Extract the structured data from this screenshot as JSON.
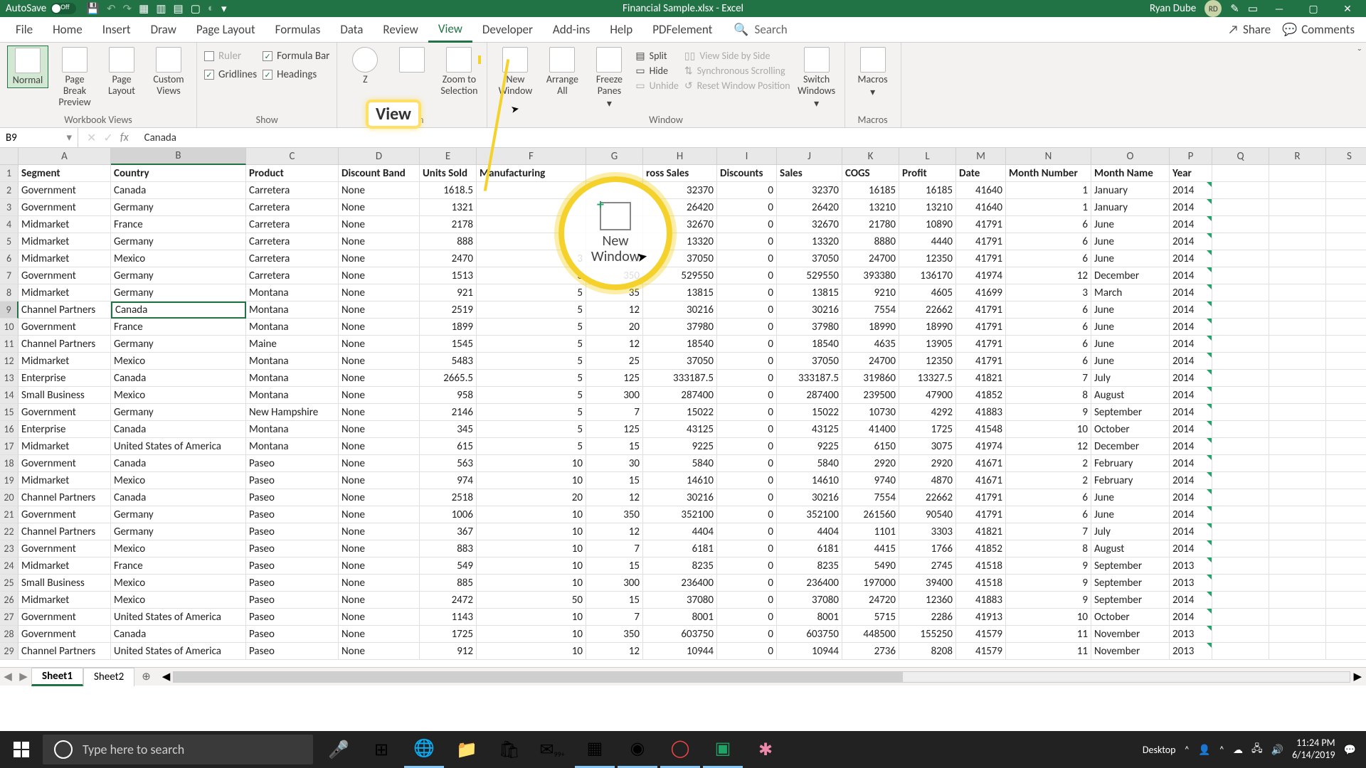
{
  "title": "Financial Sample.xlsx - Excel",
  "autosave": {
    "label": "AutoSave",
    "state": "Off"
  },
  "user": {
    "name": "Ryan Dube",
    "initials": "RD"
  },
  "tabs": [
    "File",
    "Home",
    "Insert",
    "Draw",
    "Page Layout",
    "Formulas",
    "Data",
    "Review",
    "View",
    "Developer",
    "Add-ins",
    "Help",
    "PDFelement"
  ],
  "active_tab": "View",
  "search_label": "Search",
  "share_label": "Share",
  "comments_label": "Comments",
  "ribbon": {
    "views": {
      "normal": "Normal",
      "pagebreak": "Page Break Preview",
      "pagelayout": "Page Layout",
      "custom": "Custom Views",
      "group": "Workbook Views"
    },
    "show": {
      "ruler": "Ruler",
      "formula": "Formula Bar",
      "grid": "Gridlines",
      "head": "Headings",
      "group": "Show"
    },
    "zoom": {
      "zoom": "Zoom",
      "sel": "Zoom to Selection",
      "group": "Zoom"
    },
    "window": {
      "new": "New Window",
      "arrange": "Arrange All",
      "freeze": "Freeze Panes",
      "split": "Split",
      "hide": "Hide",
      "unhide": "Unhide",
      "sbs": "View Side by Side",
      "sync": "Synchronous Scrolling",
      "reset": "Reset Window Position",
      "switch": "Switch Windows",
      "group": "Window"
    },
    "macros": {
      "macros": "Macros",
      "group": "Macros"
    }
  },
  "highlight": {
    "view": "View",
    "spotlight": "New Window"
  },
  "namebox": "B9",
  "formula": "Canada",
  "cols": [
    "A",
    "B",
    "C",
    "D",
    "E",
    "F",
    "G",
    "H",
    "I",
    "J",
    "K",
    "L",
    "M",
    "N",
    "O",
    "P",
    "Q",
    "R",
    "S"
  ],
  "headers": [
    "Segment",
    "Country",
    "Product",
    "Discount Band",
    "Units Sold",
    "Manufacturing",
    "",
    "ross Sales",
    "Discounts",
    "Sales",
    "COGS",
    "Profit",
    "Date",
    "Month Number",
    "Month Name",
    "Year"
  ],
  "rows": [
    {
      "n": 2,
      "c": [
        "Government",
        "Canada",
        "Carretera",
        "None",
        "1618.5",
        "",
        "",
        "32370",
        "0",
        "32370",
        "16185",
        "16185",
        "41640",
        "1",
        "January",
        "2014"
      ]
    },
    {
      "n": 3,
      "c": [
        "Government",
        "Germany",
        "Carretera",
        "None",
        "1321",
        "",
        "",
        "26420",
        "0",
        "26420",
        "13210",
        "13210",
        "41640",
        "1",
        "January",
        "2014"
      ]
    },
    {
      "n": 4,
      "c": [
        "Midmarket",
        "France",
        "Carretera",
        "None",
        "2178",
        "",
        "",
        "32670",
        "0",
        "32670",
        "21780",
        "10890",
        "41791",
        "6",
        "June",
        "2014"
      ]
    },
    {
      "n": 5,
      "c": [
        "Midmarket",
        "Germany",
        "Carretera",
        "None",
        "888",
        "",
        "",
        "13320",
        "0",
        "13320",
        "8880",
        "4440",
        "41791",
        "6",
        "June",
        "2014"
      ]
    },
    {
      "n": 6,
      "c": [
        "Midmarket",
        "Mexico",
        "Carretera",
        "None",
        "2470",
        "3",
        "15",
        "37050",
        "0",
        "37050",
        "24700",
        "12350",
        "41791",
        "6",
        "June",
        "2014"
      ]
    },
    {
      "n": 7,
      "c": [
        "Government",
        "Germany",
        "Carretera",
        "None",
        "1513",
        "3",
        "350",
        "529550",
        "0",
        "529550",
        "393380",
        "136170",
        "41974",
        "12",
        "December",
        "2014"
      ]
    },
    {
      "n": 8,
      "c": [
        "Midmarket",
        "Germany",
        "Montana",
        "None",
        "921",
        "5",
        "35",
        "13815",
        "0",
        "13815",
        "9210",
        "4605",
        "41699",
        "3",
        "March",
        "2014"
      ]
    },
    {
      "n": 9,
      "c": [
        "Channel Partners",
        "Canada",
        "Montana",
        "None",
        "2519",
        "5",
        "12",
        "30216",
        "0",
        "30216",
        "7554",
        "22662",
        "41791",
        "6",
        "June",
        "2014"
      ],
      "sel": 1
    },
    {
      "n": 10,
      "c": [
        "Government",
        "France",
        "Montana",
        "None",
        "1899",
        "5",
        "20",
        "37980",
        "0",
        "37980",
        "18990",
        "18990",
        "41791",
        "6",
        "June",
        "2014"
      ]
    },
    {
      "n": 11,
      "c": [
        "Channel Partners",
        "Germany",
        "Maine",
        "None",
        "1545",
        "5",
        "12",
        "18540",
        "0",
        "18540",
        "4635",
        "13905",
        "41791",
        "6",
        "June",
        "2014"
      ]
    },
    {
      "n": 12,
      "c": [
        "Midmarket",
        "Mexico",
        "Montana",
        "None",
        "5483",
        "5",
        "25",
        "37050",
        "0",
        "37050",
        "24700",
        "12350",
        "41791",
        "6",
        "June",
        "2014"
      ]
    },
    {
      "n": 13,
      "c": [
        "Enterprise",
        "Canada",
        "Montana",
        "None",
        "2665.5",
        "5",
        "125",
        "333187.5",
        "0",
        "333187.5",
        "319860",
        "13327.5",
        "41821",
        "7",
        "July",
        "2014"
      ]
    },
    {
      "n": 14,
      "c": [
        "Small Business",
        "Mexico",
        "Montana",
        "None",
        "958",
        "5",
        "300",
        "287400",
        "0",
        "287400",
        "239500",
        "47900",
        "41852",
        "8",
        "August",
        "2014"
      ]
    },
    {
      "n": 15,
      "c": [
        "Government",
        "Germany",
        "New Hampshire",
        "None",
        "2146",
        "5",
        "7",
        "15022",
        "0",
        "15022",
        "10730",
        "4292",
        "41883",
        "9",
        "September",
        "2014"
      ]
    },
    {
      "n": 16,
      "c": [
        "Enterprise",
        "Canada",
        "Montana",
        "None",
        "345",
        "5",
        "125",
        "43125",
        "0",
        "43125",
        "41400",
        "1725",
        "41548",
        "10",
        "October",
        "2014"
      ]
    },
    {
      "n": 17,
      "c": [
        "Midmarket",
        "United States of America",
        "Montana",
        "None",
        "615",
        "5",
        "15",
        "9225",
        "0",
        "9225",
        "6150",
        "3075",
        "41974",
        "12",
        "December",
        "2014"
      ]
    },
    {
      "n": 18,
      "c": [
        "Government",
        "Canada",
        "Paseo",
        "None",
        "563",
        "10",
        "30",
        "5840",
        "0",
        "5840",
        "2920",
        "2920",
        "41671",
        "2",
        "February",
        "2014"
      ]
    },
    {
      "n": 19,
      "c": [
        "Midmarket",
        "Mexico",
        "Paseo",
        "None",
        "974",
        "10",
        "15",
        "14610",
        "0",
        "14610",
        "9740",
        "4870",
        "41671",
        "2",
        "February",
        "2014"
      ]
    },
    {
      "n": 20,
      "c": [
        "Channel Partners",
        "Canada",
        "Paseo",
        "None",
        "2518",
        "20",
        "12",
        "30216",
        "0",
        "30216",
        "7554",
        "22662",
        "41791",
        "6",
        "June",
        "2014"
      ]
    },
    {
      "n": 21,
      "c": [
        "Government",
        "Germany",
        "Paseo",
        "None",
        "1006",
        "10",
        "350",
        "352100",
        "0",
        "352100",
        "261560",
        "90540",
        "41791",
        "6",
        "June",
        "2014"
      ]
    },
    {
      "n": 22,
      "c": [
        "Channel Partners",
        "Germany",
        "Paseo",
        "None",
        "367",
        "10",
        "12",
        "4404",
        "0",
        "4404",
        "1101",
        "3303",
        "41821",
        "7",
        "July",
        "2014"
      ]
    },
    {
      "n": 23,
      "c": [
        "Government",
        "Mexico",
        "Paseo",
        "None",
        "883",
        "10",
        "7",
        "6181",
        "0",
        "6181",
        "4415",
        "1766",
        "41852",
        "8",
        "August",
        "2014"
      ]
    },
    {
      "n": 24,
      "c": [
        "Midmarket",
        "France",
        "Paseo",
        "None",
        "549",
        "10",
        "15",
        "8235",
        "0",
        "8235",
        "5490",
        "2745",
        "41518",
        "9",
        "September",
        "2013"
      ]
    },
    {
      "n": 25,
      "c": [
        "Small Business",
        "Mexico",
        "Paseo",
        "None",
        "885",
        "10",
        "300",
        "236400",
        "0",
        "236400",
        "197000",
        "39400",
        "41518",
        "9",
        "September",
        "2013"
      ]
    },
    {
      "n": 26,
      "c": [
        "Midmarket",
        "Mexico",
        "Paseo",
        "None",
        "2472",
        "50",
        "15",
        "37080",
        "0",
        "37080",
        "24720",
        "12360",
        "41883",
        "9",
        "September",
        "2014"
      ]
    },
    {
      "n": 27,
      "c": [
        "Government",
        "United States of America",
        "Paseo",
        "None",
        "1143",
        "10",
        "7",
        "8001",
        "0",
        "8001",
        "5715",
        "2286",
        "41913",
        "10",
        "October",
        "2014"
      ]
    },
    {
      "n": 28,
      "c": [
        "Government",
        "Canada",
        "Paseo",
        "None",
        "1725",
        "10",
        "350",
        "603750",
        "0",
        "603750",
        "448500",
        "155250",
        "41579",
        "11",
        "November",
        "2013"
      ]
    },
    {
      "n": 29,
      "c": [
        "Channel Partners",
        "United States of America",
        "Paseo",
        "None",
        "912",
        "10",
        "12",
        "10944",
        "0",
        "10944",
        "2736",
        "8208",
        "41579",
        "11",
        "November",
        "2013"
      ]
    }
  ],
  "sheets": [
    "Sheet1",
    "Sheet2"
  ],
  "active_sheet": "Sheet1",
  "taskbar": {
    "search": "Type here to search",
    "desktop": "Desktop",
    "notif": "99+",
    "time": "11:24 PM",
    "date": "6/14/2019"
  }
}
